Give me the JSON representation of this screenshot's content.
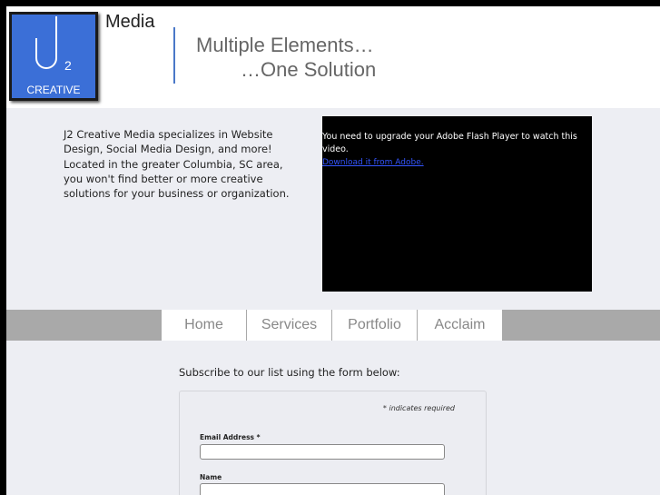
{
  "header": {
    "logo": {
      "mark": "J",
      "superscript": "2",
      "creative": "CREATIVE"
    },
    "media_word": "Media",
    "tagline_line1": "Multiple Elements…",
    "tagline_line2": "…One Solution"
  },
  "intro": {
    "text": "J2 Creative Media specializes in Website Design, Social Media Design, and more! Located in the greater Columbia, SC area, you won't find better or more creative solutions for your business or organization."
  },
  "video": {
    "message": "You need to upgrade your Adobe Flash Player to watch this video.",
    "link": "Download it from Adobe."
  },
  "nav": {
    "items": [
      {
        "label": "Home"
      },
      {
        "label": "Services"
      },
      {
        "label": "Portfolio"
      },
      {
        "label": "Acclaim"
      }
    ]
  },
  "subscribe": {
    "heading": "Subscribe to our list using the form below:",
    "required_note": "* indicates required",
    "email_label": "Email Address *",
    "email_value": "",
    "name_label": "Name",
    "name_value": ""
  },
  "colors": {
    "logo_blue": "#3b6fd7",
    "divider_blue": "#4a78c8",
    "nav_bar": "#a9a9a9",
    "page_bg": "#edeef3"
  }
}
